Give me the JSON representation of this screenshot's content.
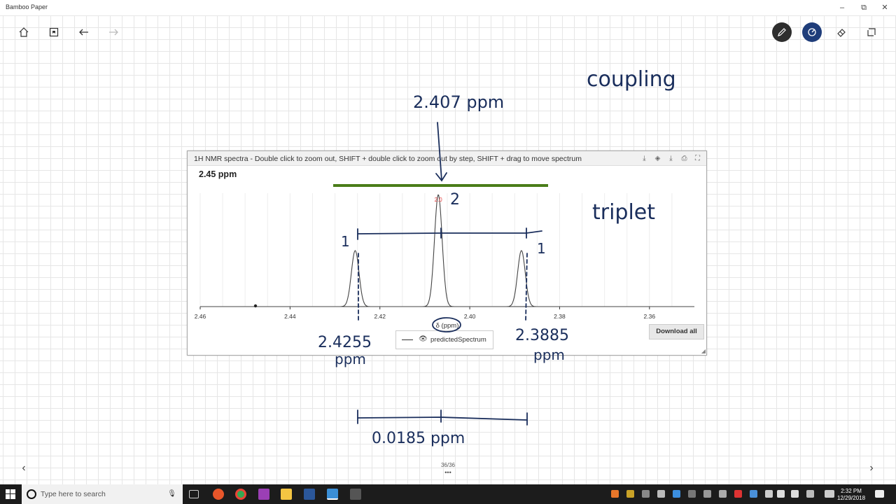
{
  "window": {
    "title": "Bamboo Paper",
    "minimize": "–",
    "maximize": "⧉",
    "close": "✕"
  },
  "toolbar_left": [
    {
      "name": "home",
      "icon": "home-icon"
    },
    {
      "name": "bookmark",
      "icon": "bookmark-icon"
    },
    {
      "name": "undo",
      "icon": "undo-icon"
    },
    {
      "name": "redo",
      "icon": "redo-icon"
    }
  ],
  "toolbar_right": [
    {
      "name": "pen",
      "icon": "pen-icon",
      "active": true
    },
    {
      "name": "color",
      "icon": "color-picker-icon",
      "color": "#1f3d7a"
    },
    {
      "name": "eraser",
      "icon": "eraser-icon"
    },
    {
      "name": "select",
      "icon": "lasso-icon"
    }
  ],
  "panel": {
    "title": "1H NMR spectra - Double click to zoom out, SHIFT + double click to zoom out by step, SHIFT + drag to move spectrum",
    "ppm_readout": "2.45 ppm",
    "peak_label": "2.0",
    "axis_title": "δ (ppm)",
    "legend_label": "predictedSpectrum",
    "download_label": "Download all",
    "icons": [
      "download-icon",
      "eraser-icon",
      "save-icon",
      "print-icon",
      "fullscreen-icon"
    ]
  },
  "chart_data": {
    "type": "line",
    "title": "1H NMR spectra - Double click to zoom out, SHIFT + double click to zoom out by step, SHIFT + drag to move spectrum",
    "xlabel": "δ (ppm)",
    "ylabel": "",
    "xlim": [
      2.46,
      2.35
    ],
    "x_reversed": true,
    "tick_labels": [
      "2.46",
      "2.44",
      "2.42",
      "2.40",
      "2.38",
      "2.36"
    ],
    "series": [
      {
        "name": "predictedSpectrum",
        "peaks": [
          {
            "x": 2.4255,
            "relative_height": 0.5
          },
          {
            "x": 2.407,
            "relative_height": 1.0
          },
          {
            "x": 2.3885,
            "relative_height": 0.5
          }
        ]
      }
    ],
    "peak_label": "2.0",
    "grid": true,
    "legend": "bottom-center"
  },
  "annotations": {
    "coupling": "coupling",
    "center_shift": "2.407 ppm",
    "triplet": "triplet",
    "left_shift_value": "2.4255",
    "left_shift_unit": "ppm",
    "right_shift_value": "2.3885",
    "right_shift_unit": "ppm",
    "spacing": "0.0185 ppm",
    "int_center": "2",
    "int_left": "1",
    "int_right": "1"
  },
  "footer": {
    "page": "36/36",
    "more": "•••",
    "prev": "‹",
    "next": "›"
  },
  "taskbar": {
    "search_placeholder": "Type here to search",
    "time": "2:32 PM",
    "date": "12/29/2018"
  }
}
